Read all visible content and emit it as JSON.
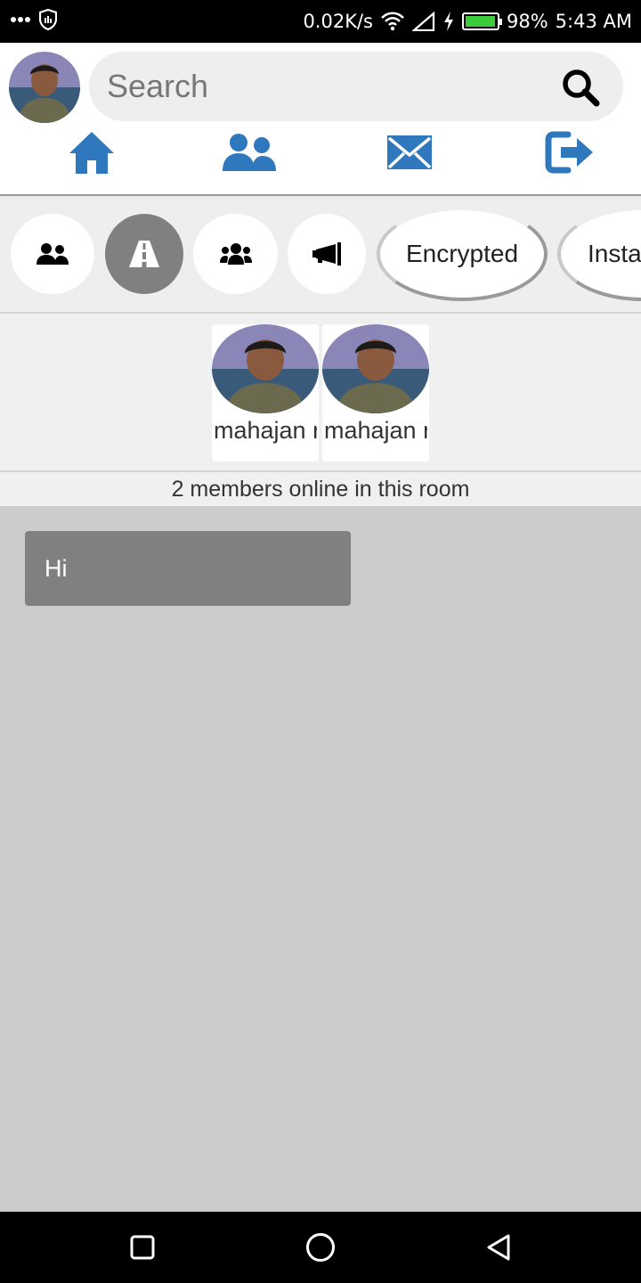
{
  "status_bar": {
    "network_speed": "0.02K/s",
    "battery_percent": "98%",
    "battery_level": 0.98,
    "time": "5:43 AM",
    "icons": [
      "more-icon",
      "shield-icon",
      "wifi-icon",
      "signal-icon",
      "charging-icon",
      "battery-icon"
    ]
  },
  "header": {
    "search": {
      "placeholder": "Search",
      "value": ""
    },
    "nav": [
      {
        "name": "home",
        "icon": "home-icon"
      },
      {
        "name": "friends",
        "icon": "users-icon"
      },
      {
        "name": "messages",
        "icon": "mail-icon"
      },
      {
        "name": "logout",
        "icon": "sign-out-icon"
      }
    ]
  },
  "categories": {
    "items": [
      {
        "icon": "user-friends-icon",
        "active": false
      },
      {
        "icon": "road-icon",
        "active": true
      },
      {
        "icon": "users-group-icon",
        "active": false
      },
      {
        "icon": "bullhorn-icon",
        "active": false
      }
    ],
    "labels": [
      "Encrypted",
      "Insta"
    ]
  },
  "members": {
    "list": [
      {
        "name": "mahajan r"
      },
      {
        "name": "mahajan r"
      }
    ],
    "online_text": "2 members online in this room"
  },
  "chat": {
    "messages": [
      {
        "text": "Hi"
      }
    ]
  },
  "colors": {
    "accent": "#2f78bd",
    "active_category": "#808080",
    "message_bubble": "#808080",
    "chat_background": "#cccccc",
    "battery": "#3ccc3c"
  }
}
